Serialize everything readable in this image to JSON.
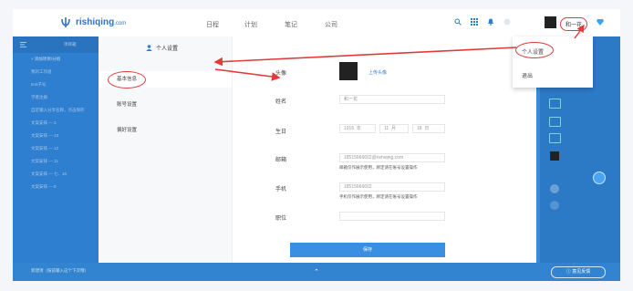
{
  "app": {
    "brand": "rishiqing",
    "brand_suffix": ".com"
  },
  "topnav": {
    "links": [
      "日程",
      "计划",
      "笔记",
      "公司"
    ],
    "user_name": "和一花"
  },
  "sidebar": {
    "header": "项目箱",
    "add_label": "+ 添加项目/分组",
    "items": [
      "我的工作组",
      "test子号",
      "学者注册",
      "自定输入分享名称，点击保存",
      "文案安排 — 3",
      "文案安排 — 13",
      "文案安排 — 12",
      "文案安排 — 11",
      "文案安排 — 七、16",
      "文案安排 — 8"
    ]
  },
  "bottombar": {
    "hint": "新建项（按前输入这个下次哦）",
    "feedback": "意见反馈"
  },
  "modal": {
    "title": "个人设置",
    "nav": [
      "基本信息",
      "账号设置",
      "偏好设置"
    ],
    "avatar_label": "头像",
    "upload_label": "上传头像",
    "name_label": "姓名",
    "name_value": "和一花",
    "birthday_label": "生日",
    "birthday": {
      "year": "1916",
      "year_unit": "年",
      "month": "11",
      "month_unit": "月",
      "day": "18",
      "day_unit": "日"
    },
    "email_label": "邮箱",
    "email_value": "18515666602@rishiqing.com",
    "email_hint": "邮箱仅作展示使用，绑定请在账号设置操作",
    "phone_label": "手机",
    "phone_value": "18515666602",
    "phone_hint": "手机仅作展示使用，绑定请在账号设置操作",
    "position_label": "职位",
    "position_value": "",
    "save_label": "保存"
  },
  "dropdown": {
    "items": [
      "个人设置",
      "退出"
    ]
  },
  "colors": {
    "primary": "#2f7fd0",
    "annotation": "#e23b3b"
  }
}
